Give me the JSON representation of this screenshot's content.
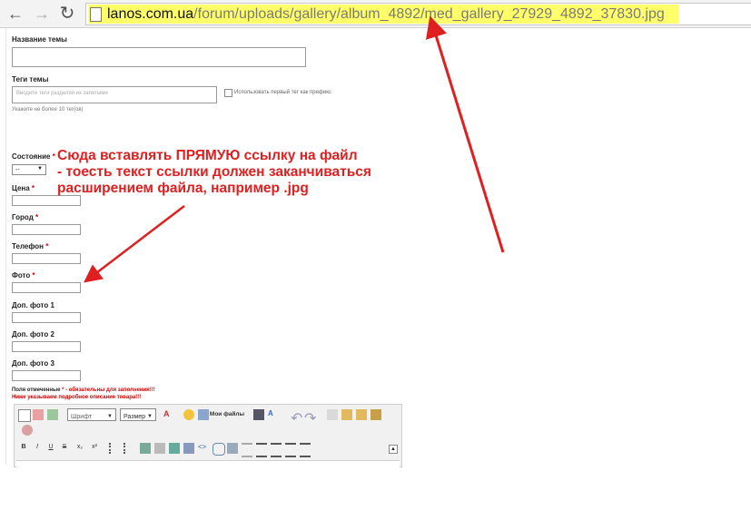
{
  "browser": {
    "back_icon": "arrow-left-icon",
    "forward_icon": "arrow-right-icon",
    "reload_icon": "reload-icon",
    "url_host": "lanos.com.ua",
    "url_path": "/forum/uploads/gallery/album_4892/med_gallery_27929_4892_37830.jpg",
    "highlight_color": "#ffff6a"
  },
  "form": {
    "topic_title_label": "Название темы",
    "tags_label": "Теги темы",
    "tags_placeholder": "Вводите теги разделяя их запятыми",
    "tags_prefix_label": "Использовать первый тег как префикс",
    "tags_hint": "Укажите не более 10 тег(ов)",
    "state_label": "Состояние",
    "state_value": "--",
    "price_label": "Цена",
    "city_label": "Город",
    "phone_label": "Телефон",
    "photo_label": "Фото",
    "extra_photo_1_label": "Доп. фото 1",
    "extra_photo_2_label": "Доп. фото 2",
    "extra_photo_3_label": "Доп. фото 3",
    "required_mark": "*",
    "required_note_prefix": "Поля отмеченные ",
    "required_note_suffix": " - обязательны для заполнения!!!",
    "description_note": "Ниже указываем подробное описание товара!!!"
  },
  "editor": {
    "font_label": "Шрифт",
    "size_label": "Размер",
    "my_files_label": "Мои файлы",
    "format_buttons": [
      "B",
      "I",
      "U",
      "S",
      "x₂",
      "x²"
    ]
  },
  "annotation": {
    "line1": "Сюда вставлять ПРЯМУЮ ссылку на файл",
    "line2": "- тоесть текст ссылки должен заканчиваться",
    "line3": "расширением файла, например .jpg",
    "color": "#e02020"
  }
}
